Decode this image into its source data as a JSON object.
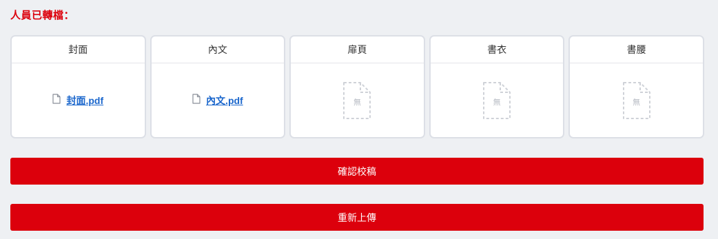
{
  "heading": "人員已轉檔：",
  "cards": [
    {
      "title": "封面",
      "file": "封面.pdf",
      "empty_label": null
    },
    {
      "title": "內文",
      "file": "內文.pdf",
      "empty_label": null
    },
    {
      "title": "扉頁",
      "file": null,
      "empty_label": "無"
    },
    {
      "title": "書衣",
      "file": null,
      "empty_label": "無"
    },
    {
      "title": "書腰",
      "file": null,
      "empty_label": "無"
    }
  ],
  "buttons": {
    "confirm_label": "確認校稿",
    "reupload_label": "重新上傳"
  },
  "colors": {
    "accent": "#dc000c",
    "link": "#1a66cc",
    "background": "#eef0f3",
    "card_border": "#dcdfe6"
  },
  "icons": {
    "file": "document-icon",
    "empty": "empty-file-icon"
  }
}
